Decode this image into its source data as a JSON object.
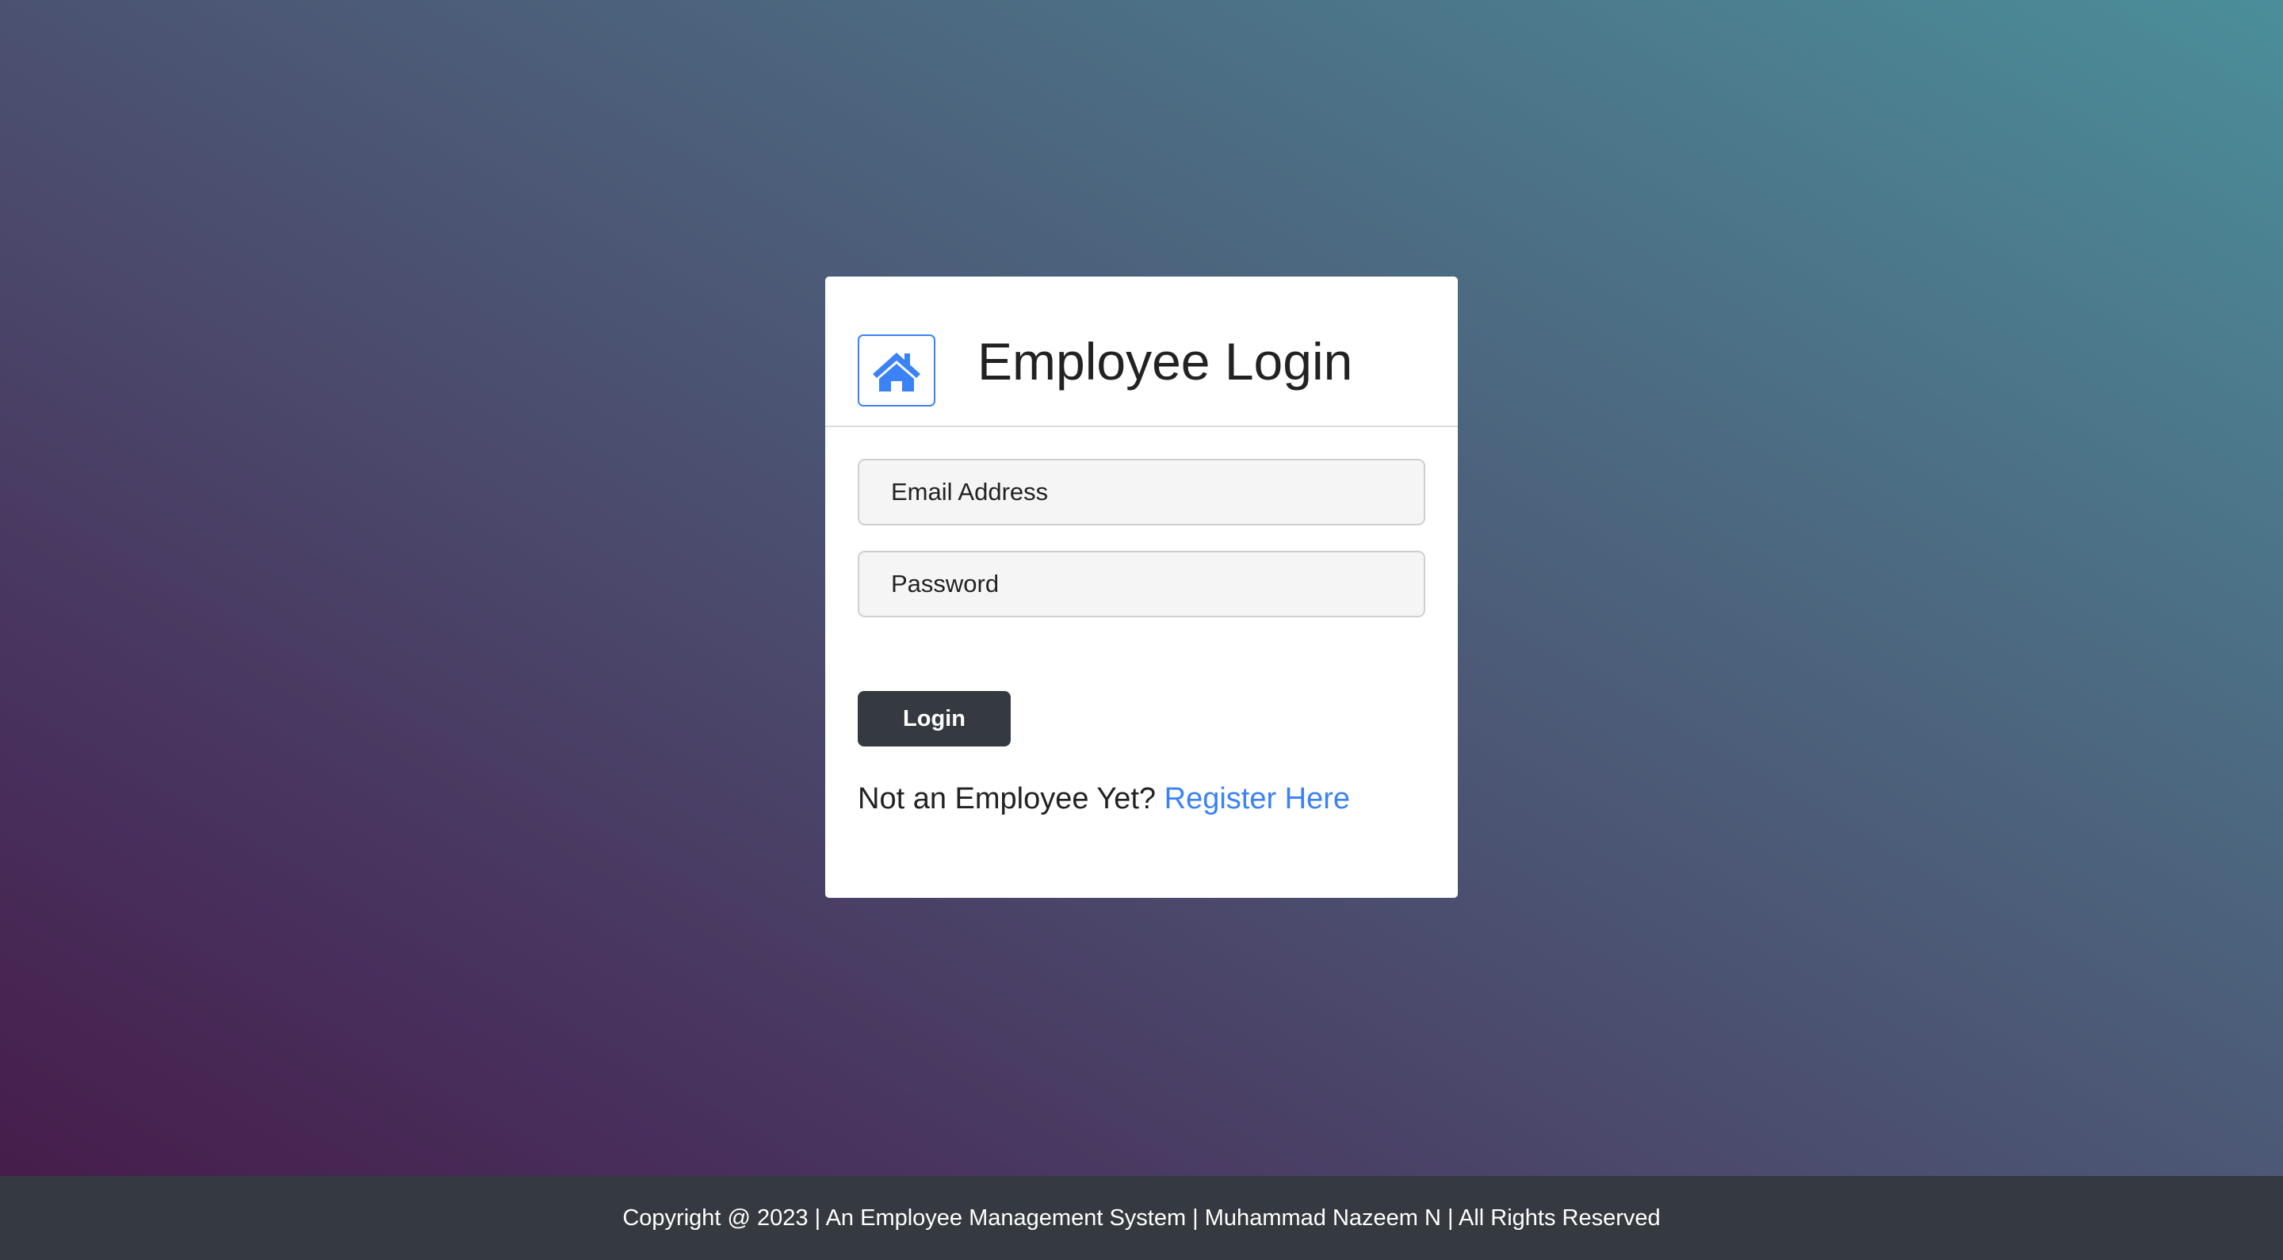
{
  "login_card": {
    "title": "Employee Login",
    "home_icon": "home-icon",
    "email_placeholder": "Email Address",
    "email_value": "",
    "password_placeholder": "Password",
    "password_value": "",
    "login_label": "Login",
    "register_prompt": "Not an Employee Yet?",
    "register_link": "Register Here"
  },
  "footer": {
    "text": "Copyright @ 2023 | An Employee Management System | Muhammad Nazeem N | All Rights Reserved"
  },
  "colors": {
    "accent": "#3b82f6",
    "button_dark": "#343a40",
    "footer_bg": "#343a40",
    "card_bg": "#ffffff"
  }
}
